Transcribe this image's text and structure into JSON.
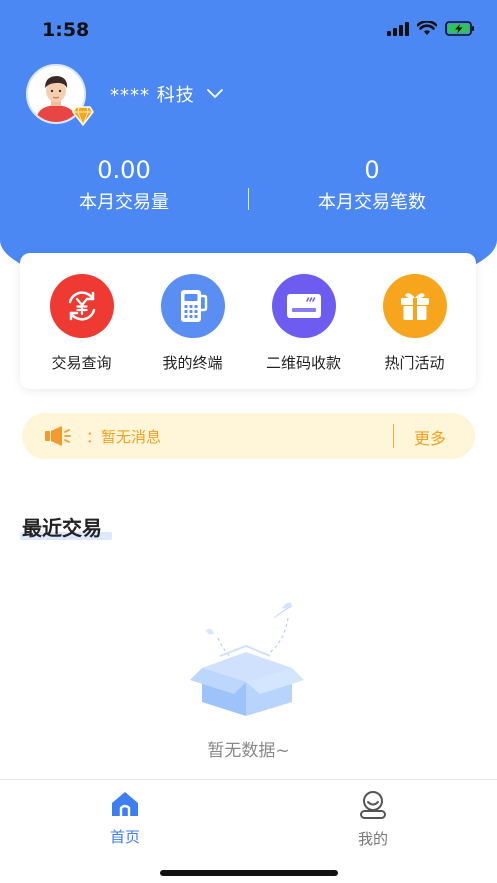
{
  "status_bar": {
    "time": "1:58"
  },
  "profile": {
    "company_name": "**** 科技"
  },
  "stats": [
    {
      "value": "0.00",
      "label": "本月交易量"
    },
    {
      "value": "0",
      "label": "本月交易笔数"
    }
  ],
  "functions": [
    {
      "label": "交易查询",
      "icon": "exchange-yen-icon",
      "color": "#ee3a33"
    },
    {
      "label": "我的终端",
      "icon": "pos-terminal-icon",
      "color": "#5a8ef2"
    },
    {
      "label": "二维码收款",
      "icon": "card-icon",
      "color": "#6e5cf0"
    },
    {
      "label": "热门活动",
      "icon": "gift-icon",
      "color": "#f7a51d"
    }
  ],
  "notice": {
    "text": "：暂无消息",
    "more_label": "更多"
  },
  "recent": {
    "title": "最近交易",
    "empty_text": "暂无数据~"
  },
  "tabbar": [
    {
      "label": "首页",
      "icon": "home-icon",
      "active": true
    },
    {
      "label": "我的",
      "icon": "user-icon",
      "active": false
    }
  ],
  "colors": {
    "primary": "#4b88f4",
    "notice_bg": "#fff5d8",
    "notice_text": "#f0a020"
  }
}
